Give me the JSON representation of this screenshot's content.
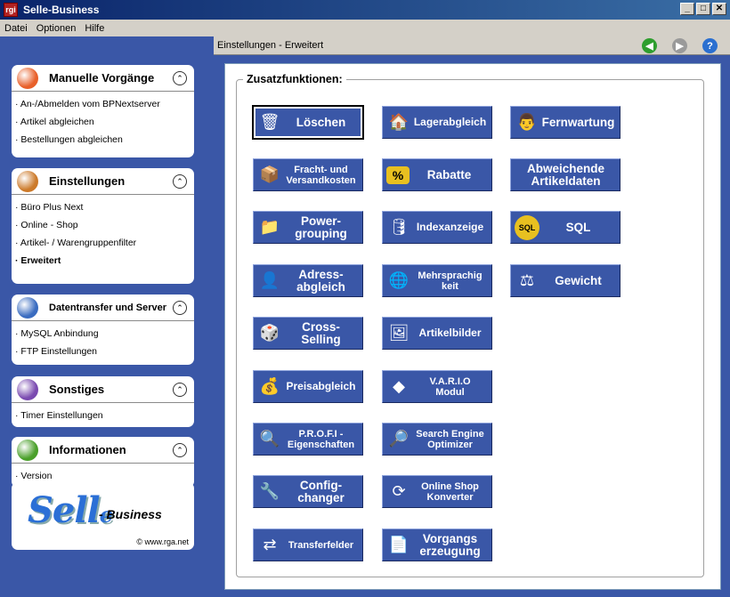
{
  "window": {
    "title": "Selle-Business",
    "icon_text": "rgi",
    "icon": "app-icon"
  },
  "window_controls": {
    "minimize": "_",
    "maximize": "□",
    "close": "✕"
  },
  "menu": [
    "Datei",
    "Optionen",
    "Hilfe"
  ],
  "header": {
    "breadcrumb": "Einstellungen - Erweitert",
    "nav": [
      {
        "name": "back",
        "icon": "back-arrow-icon",
        "symbol": "◀",
        "color": "#2e9e2e"
      },
      {
        "name": "forward",
        "icon": "forward-arrow-icon",
        "symbol": "▶",
        "color": "#9a9a9a"
      },
      {
        "name": "help",
        "icon": "help-icon",
        "symbol": "?",
        "color": "#2a6fd0"
      }
    ]
  },
  "sidebar": {
    "panels": [
      {
        "title": "Manuelle Vorgänge",
        "icon": "play-icon",
        "color": "#e8602a",
        "items": [
          "An-/Abmelden vom BPNextserver",
          "Artikel abgleichen",
          "Bestellungen abgleichen"
        ]
      },
      {
        "title": "Einstellungen",
        "icon": "tools-icon",
        "color": "#cc7a2a",
        "items": [
          "Büro Plus Next",
          "Online - Shop",
          "Artikel- / Warengruppenfilter",
          "Erweitert"
        ],
        "active_index": 3
      },
      {
        "title": "Datentransfer und Server",
        "icon": "computer-icon",
        "color": "#3a6cc0",
        "items": [
          "MySQL Anbindung",
          "FTP Einstellungen"
        ]
      },
      {
        "title": "Sonstiges",
        "icon": "misc-icon",
        "color": "#7a4ab0",
        "items": [
          "Timer Einstellungen"
        ]
      },
      {
        "title": "Informationen",
        "icon": "info-icon",
        "color": "#4aa02a",
        "items": [
          "Version"
        ]
      }
    ],
    "collapse_symbol": "⌃",
    "logo": {
      "sel": "Sell",
      "e": "e",
      "business": "- Business",
      "url": "© www.rga.net"
    }
  },
  "content": {
    "group_title": "Zusatzfunktionen:",
    "buttons": [
      {
        "label": "Löschen",
        "icon": "trash-icon",
        "glyph": "🗑",
        "selected": true
      },
      {
        "label": "Fracht- und\nVersandkosten",
        "icon": "shipping-icon",
        "glyph": "📦"
      },
      {
        "label": "Power-\ngrouping",
        "icon": "folder-icon",
        "glyph": "📁"
      },
      {
        "label": "Adress-\nabgleich",
        "icon": "address-icon",
        "glyph": "👤"
      },
      {
        "label": "Cross-\nSelling",
        "icon": "cross-selling-icon",
        "glyph": "🎲"
      },
      {
        "label": "Preisabgleich",
        "icon": "price-icon",
        "glyph": "💰"
      },
      {
        "label": "P.R.O.F.I -\nEigenschaften",
        "icon": "magnifier-icon",
        "glyph": "🔍"
      },
      {
        "label": "Config-\nchanger",
        "icon": "wrench-icon",
        "glyph": "🔧"
      },
      {
        "label": "Transferfelder",
        "icon": "transfer-icon",
        "glyph": "⇄"
      },
      {
        "label": "Lagerabgleich",
        "icon": "house-icon",
        "glyph": "🏠"
      },
      {
        "label": "Rabatte",
        "icon": "percent-icon",
        "glyph": "%"
      },
      {
        "label": "Indexanzeige",
        "icon": "database-icon",
        "glyph": "🛢"
      },
      {
        "label": "Mehrsprachig\nkeit",
        "icon": "globe-icon",
        "glyph": "🌐"
      },
      {
        "label": "Artikelbilder",
        "icon": "image-icon",
        "glyph": "🖼"
      },
      {
        "label": "V.A.R.I.O\nModul",
        "icon": "cubes-icon",
        "glyph": "◆"
      },
      {
        "label": "Search Engine\nOptimizer",
        "icon": "seo-icon",
        "glyph": "🔎"
      },
      {
        "label": "Online Shop\nKonverter",
        "icon": "convert-icon",
        "glyph": "⟳"
      },
      {
        "label": "Vorgangs\nerzeugung",
        "icon": "document-icon",
        "glyph": "📄"
      },
      {
        "label": "Fernwartung",
        "icon": "support-icon",
        "glyph": "👨"
      },
      {
        "label": "Abweichende\nArtikeldaten",
        "icon": "",
        "glyph": ""
      },
      {
        "label": "SQL",
        "icon": "sql-icon",
        "glyph": "SQL"
      },
      {
        "label": "Gewicht",
        "icon": "scale-icon",
        "glyph": "⚖"
      }
    ]
  }
}
